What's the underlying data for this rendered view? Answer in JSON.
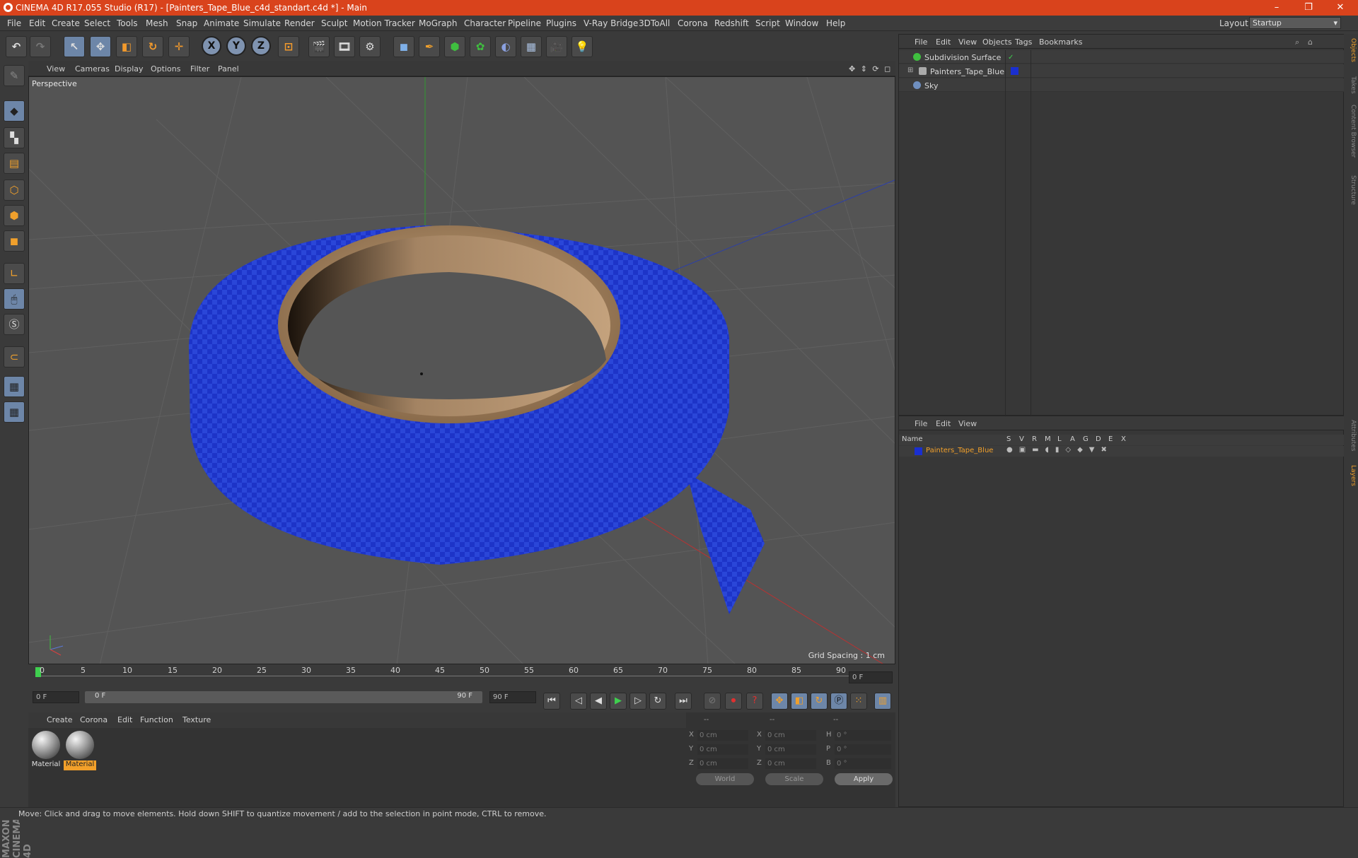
{
  "window": {
    "title": "CINEMA 4D R17.055 Studio (R17) - [Painters_Tape_Blue_c4d_standart.c4d *] - Main",
    "minimize": "–",
    "restore": "❐",
    "close": "✕"
  },
  "menubar": {
    "items": [
      "File",
      "Edit",
      "Create",
      "Select",
      "Tools",
      "Mesh",
      "Snap",
      "Animate",
      "Simulate",
      "Render",
      "Sculpt",
      "Motion Tracker",
      "MoGraph",
      "Character",
      "Pipeline",
      "Plugins",
      "V-Ray Bridge",
      "3DToAll",
      "Corona",
      "Redshift",
      "Script",
      "Window",
      "Help"
    ],
    "layout_label": "Layout:",
    "layout_value": "Startup"
  },
  "toolbar": {
    "undo": "↶",
    "redo": "↷",
    "select": "↖",
    "move": "✥",
    "scale": "◧",
    "rotate": "↻",
    "transform": "✛",
    "x": "X",
    "y": "Y",
    "z": "Z",
    "coord": "⊡",
    "render_view": "🎬",
    "render_pv": "🎞",
    "render_settings": "⚙",
    "cube": "◼",
    "pen": "✒",
    "subdiv": "⬢",
    "cloner": "✿",
    "deformer": "◐",
    "floor": "▦",
    "camera": "🎥",
    "light": "💡"
  },
  "viewport": {
    "menu": [
      "View",
      "Cameras",
      "Display",
      "Options",
      "Filter",
      "Panel"
    ],
    "label": "Perspective",
    "grid_spacing": "Grid Spacing : 1 cm",
    "nav_icons": "✥ ⇕ ⟳ ◻"
  },
  "timeline": {
    "ticks": [
      "0",
      "5",
      "10",
      "15",
      "20",
      "25",
      "30",
      "35",
      "40",
      "45",
      "50",
      "55",
      "60",
      "65",
      "70",
      "75",
      "80",
      "85",
      "90"
    ],
    "current_frame": "0 F",
    "start_field": "0 F",
    "range_start": "0 F",
    "range_end": "90 F",
    "end_field": "90 F"
  },
  "materials": {
    "menu": [
      "Create",
      "Corona",
      "Edit",
      "Function",
      "Texture"
    ],
    "items": [
      {
        "label": "Material",
        "active": false
      },
      {
        "label": "Material",
        "active": true
      }
    ]
  },
  "coordinates": {
    "header": [
      "--",
      "--",
      "--"
    ],
    "rows": [
      {
        "a": "X",
        "v1": "0 cm",
        "b": "X",
        "v2": "0 cm",
        "c": "H",
        "v3": "0 °"
      },
      {
        "a": "Y",
        "v1": "0 cm",
        "b": "Y",
        "v2": "0 cm",
        "c": "P",
        "v3": "0 °"
      },
      {
        "a": "Z",
        "v1": "0 cm",
        "b": "Z",
        "v2": "0 cm",
        "c": "B",
        "v3": "0 °"
      }
    ],
    "space": "World",
    "mode": "Scale",
    "apply": "Apply"
  },
  "objects": {
    "menu": [
      "File",
      "Edit",
      "View",
      "Objects",
      "Tags",
      "Bookmarks"
    ],
    "tree": [
      {
        "name": "Subdivision Surface",
        "color": "#3fbf3f"
      },
      {
        "name": "Painters_Tape_Blue",
        "color": "#aaaaaa"
      },
      {
        "name": "Sky",
        "color": "#6f8fbf"
      }
    ]
  },
  "layers": {
    "menu": [
      "File",
      "Edit",
      "View"
    ],
    "header_name": "Name",
    "header_cols": [
      "S",
      "V",
      "R",
      "M",
      "L",
      "A",
      "G",
      "D",
      "E",
      "X"
    ],
    "rows": [
      {
        "name": "Painters_Tape_Blue",
        "color": "#1a2fd0"
      }
    ]
  },
  "sidetabs": [
    "Objects",
    "Takes",
    "Content Browser",
    "Structure",
    "Attributes",
    "Layers"
  ],
  "status": "Move: Click and drag to move elements. Hold down SHIFT to quantize movement / add to the selection in point mode, CTRL to remove.",
  "logo": "MAXON CINEMA 4D"
}
